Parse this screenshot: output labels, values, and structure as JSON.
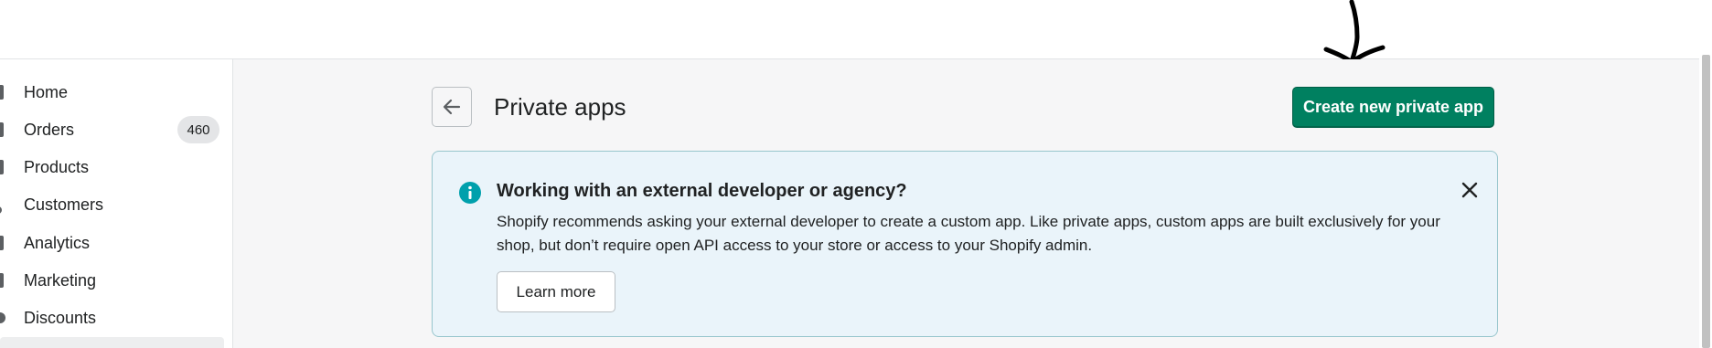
{
  "sidebar": {
    "items": [
      {
        "label": "Home"
      },
      {
        "label": "Orders",
        "badge": "460"
      },
      {
        "label": "Products"
      },
      {
        "label": "Customers"
      },
      {
        "label": "Analytics"
      },
      {
        "label": "Marketing"
      },
      {
        "label": "Discounts"
      }
    ]
  },
  "page": {
    "title": "Private apps",
    "primary_action": "Create new private app"
  },
  "banner": {
    "title": "Working with an external developer or agency?",
    "text": "Shopify recommends asking your external developer to create a custom app. Like private apps, custom apps are built exclusively for your shop, but don’t require open API access to your store or access to your Shopify admin.",
    "button": "Learn more"
  },
  "colors": {
    "primary": "#008060",
    "info": "#00a0ac",
    "banner_bg": "#eaf4fa"
  },
  "icons": {
    "back": "arrow-left-icon",
    "info": "info-icon",
    "close": "close-icon"
  }
}
